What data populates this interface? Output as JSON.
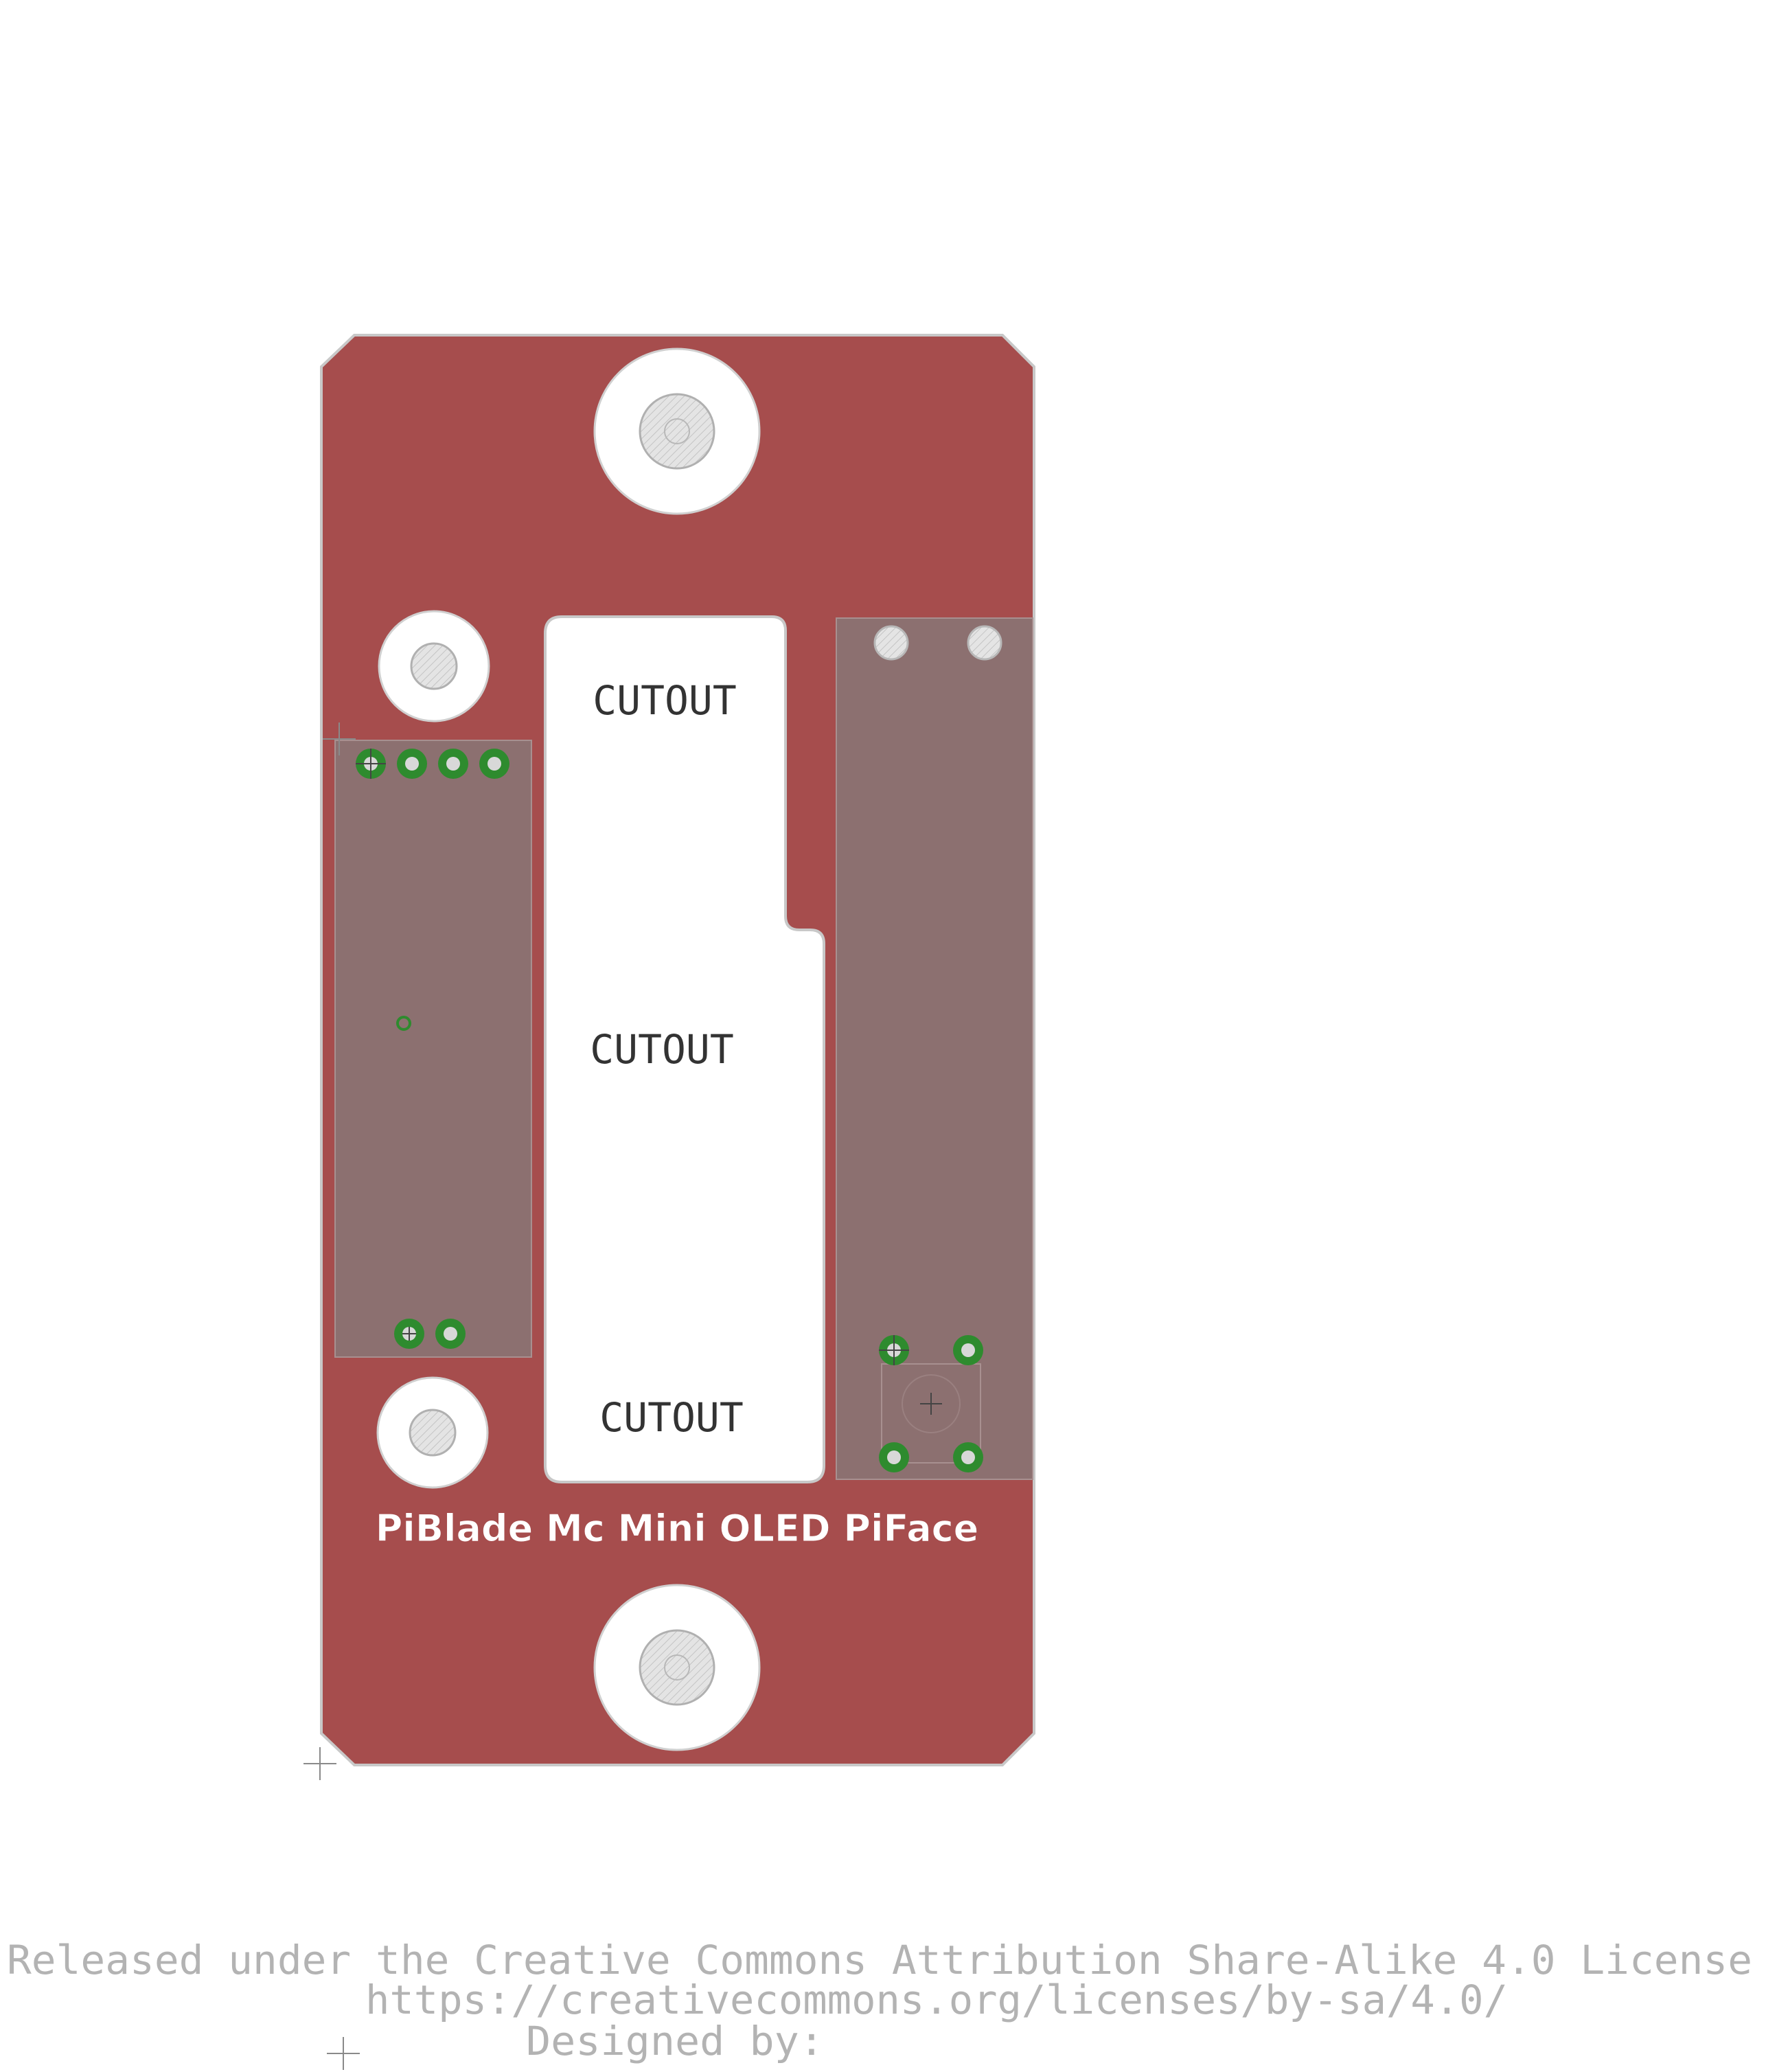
{
  "board": {
    "cutout_label": "CUTOUT",
    "board_label": "PiBlade Mc Mini OLED PiFace",
    "colors": {
      "copper": "#a64d4d",
      "outline": "#c8c8c8",
      "component": "#8c7070",
      "pad": "#2e8b2e",
      "silk_text": "#333333",
      "hole_fill": "#e0e0e0"
    }
  },
  "footer": {
    "license_line": "Released under the Creative Commons Attribution Share-Alike 4.0 License",
    "url_line": "https://creativecommons.org/licenses/by-sa/4.0/",
    "designer_line": "Designed by:"
  }
}
